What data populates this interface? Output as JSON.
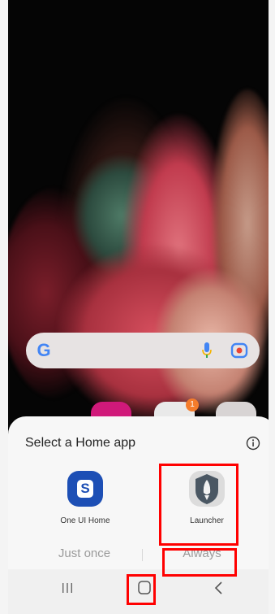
{
  "home_screen": {
    "search": {
      "logo": "G",
      "mic_icon": "mic-icon",
      "lens_icon": "lens-icon"
    },
    "dock_badge": "1"
  },
  "dialog": {
    "title": "Select a Home app",
    "info_icon": "info-icon",
    "apps": [
      {
        "label": "One UI Home",
        "icon": "one-ui-home-icon",
        "icon_letter": "S",
        "color": "#1d4fb5"
      },
      {
        "label": "Launcher",
        "icon": "launcher-icon",
        "color": "#4a5763"
      }
    ],
    "buttons": {
      "just_once": "Just once",
      "always": "Always"
    }
  },
  "navbar": {
    "recents_icon": "recents-icon",
    "home_icon": "home-icon",
    "back_icon": "back-icon"
  },
  "colors": {
    "highlight": "#ff0000",
    "sheet_bg": "#f7f7f7"
  }
}
